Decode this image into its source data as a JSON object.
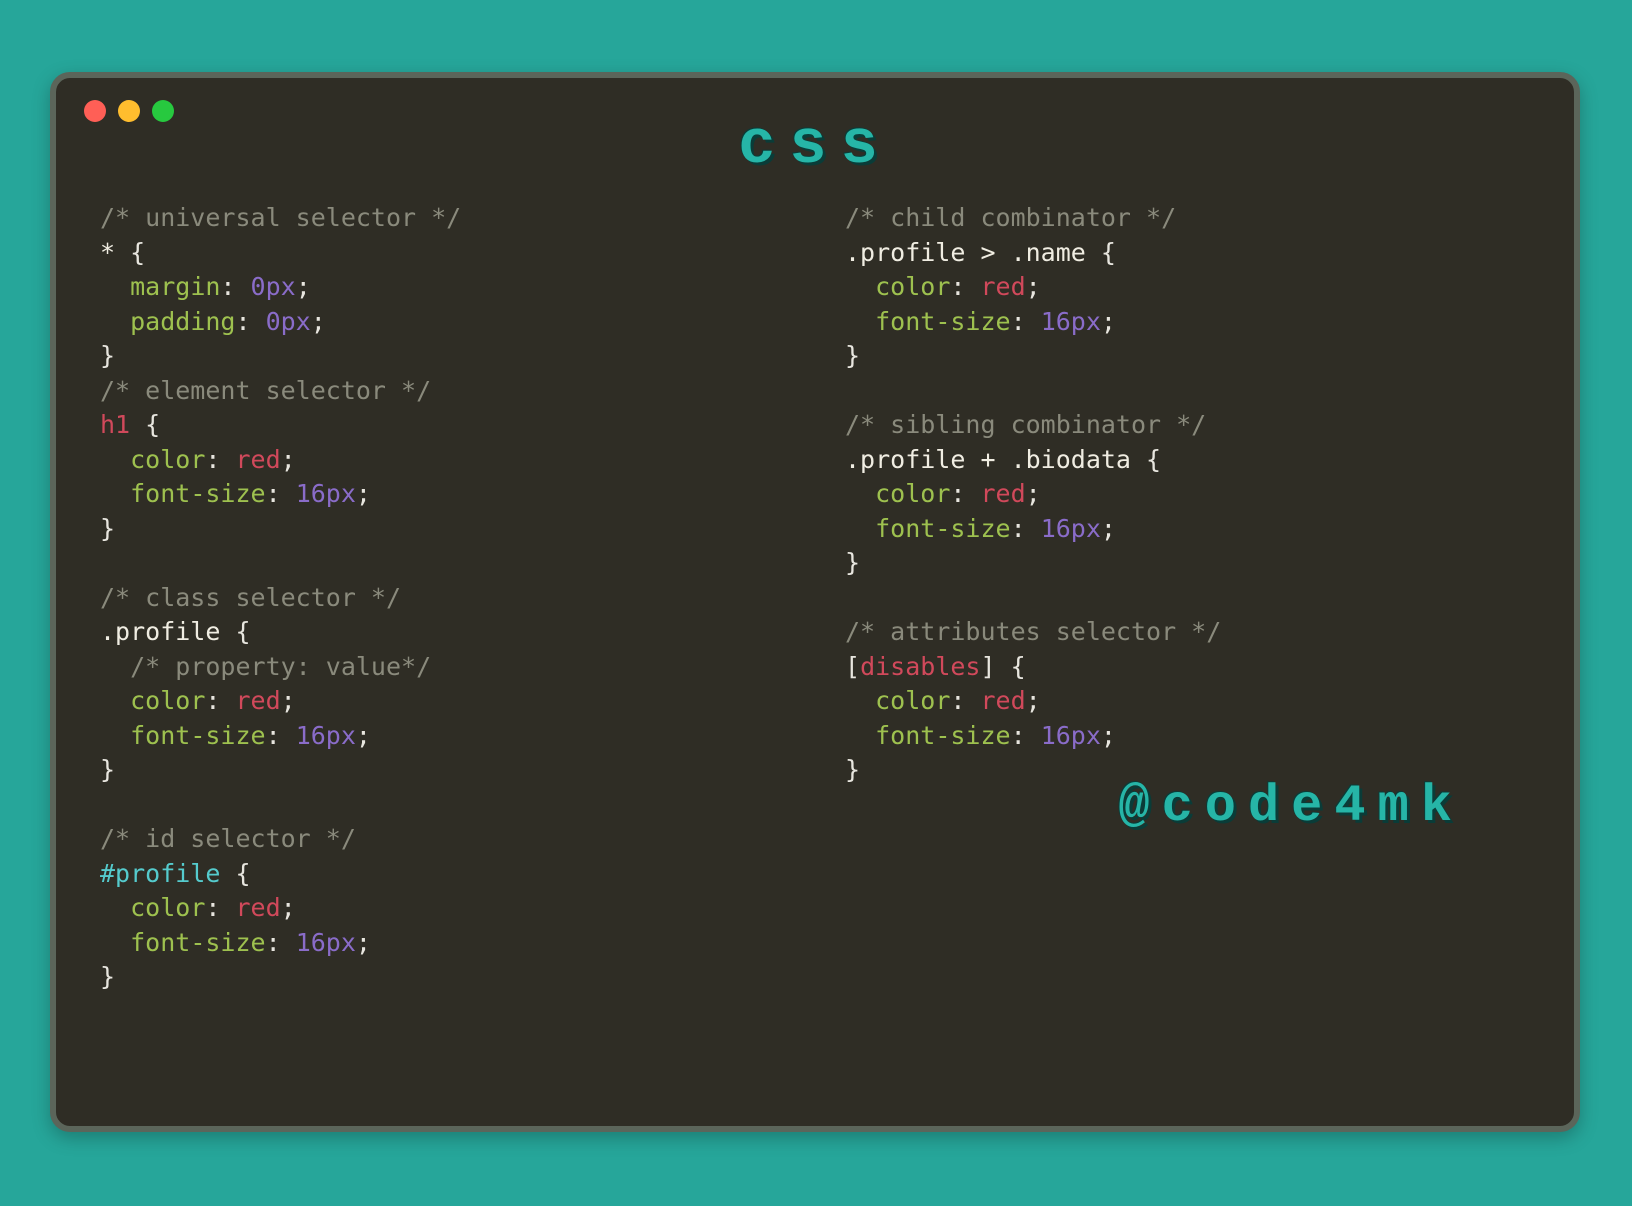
{
  "title": "css",
  "credit": "@code4mk",
  "traffic_colors": {
    "red": "#ff5f56",
    "yellow": "#ffbd2e",
    "green": "#27c93f"
  },
  "accent_color": "#26b5a7",
  "background_color": "#26a69a",
  "window_color": "#2f2d25",
  "left": {
    "block1": {
      "comment": "/* universal selector */",
      "sel_star": "*",
      "brace_open": " {",
      "prop_margin": "margin",
      "val_margin": "0px",
      "prop_padding": "padding",
      "val_padding": "0px",
      "brace_close": "}"
    },
    "block2": {
      "comment": "/* element selector */",
      "sel": "h1",
      "brace_open": " {",
      "prop_color": "color",
      "val_color": "red",
      "prop_fs": "font-size",
      "val_fs": "16px",
      "brace_close": "}"
    },
    "block3": {
      "comment": "/* class selector */",
      "sel": ".profile",
      "brace_open": " {",
      "inner_comment": "/* property: value*/",
      "prop_color": "color",
      "val_color": "red",
      "prop_fs": "font-size",
      "val_fs": "16px",
      "brace_close": "}"
    },
    "block4": {
      "comment": "/* id selector */",
      "sel": "#profile",
      "brace_open": " {",
      "prop_color": "color",
      "val_color": "red",
      "prop_fs": "font-size",
      "val_fs": "16px",
      "brace_close": "}"
    }
  },
  "right": {
    "block1": {
      "comment": "/* child combinator */",
      "sel": ".profile > .name",
      "brace_open": " {",
      "prop_color": "color",
      "val_color": "red",
      "prop_fs": "font-size",
      "val_fs": "16px",
      "brace_close": "}"
    },
    "block2": {
      "comment": "/* sibling combinator */",
      "sel": ".profile + .biodata",
      "brace_open": " {",
      "prop_color": "color",
      "val_color": "red",
      "prop_fs": "font-size",
      "val_fs": "16px",
      "brace_close": "}"
    },
    "block3": {
      "comment": "/* attributes selector */",
      "sel_open": "[",
      "sel_attr": "disables",
      "sel_close": "]",
      "brace_open": " {",
      "prop_color": "color",
      "val_color": "red",
      "prop_fs": "font-size",
      "val_fs": "16px",
      "brace_close": "}"
    }
  }
}
